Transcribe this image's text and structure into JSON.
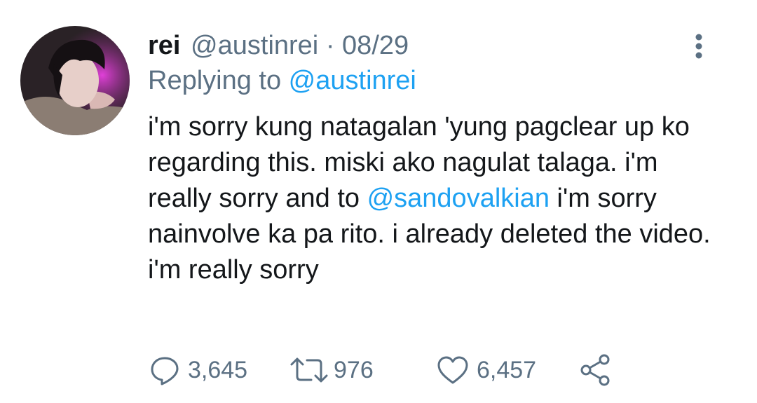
{
  "tweet": {
    "name": "rei",
    "handle": "@austinrei",
    "separator": " · ",
    "date": "08/29",
    "replying_prefix": "Replying to ",
    "replying_to": "@austinrei",
    "text_part1": "i'm sorry kung natagalan 'yung pagclear up ko regarding this. miski ako nagulat talaga. i'm really sorry and to ",
    "mention": "@sandovalkian",
    "text_part2": " i'm sorry nainvolve ka pa rito. i already deleted the video. i'm really sorry",
    "avatar_description_icon": "profile-photo",
    "more_icon": "vertical-ellipsis-icon"
  },
  "actions": {
    "replies": "3,645",
    "retweets": "976",
    "likes": "6,457",
    "share_icon": "share-icon"
  },
  "colors": {
    "text": "#14171a",
    "secondary": "#5b7083",
    "link": "#1da1f2"
  }
}
